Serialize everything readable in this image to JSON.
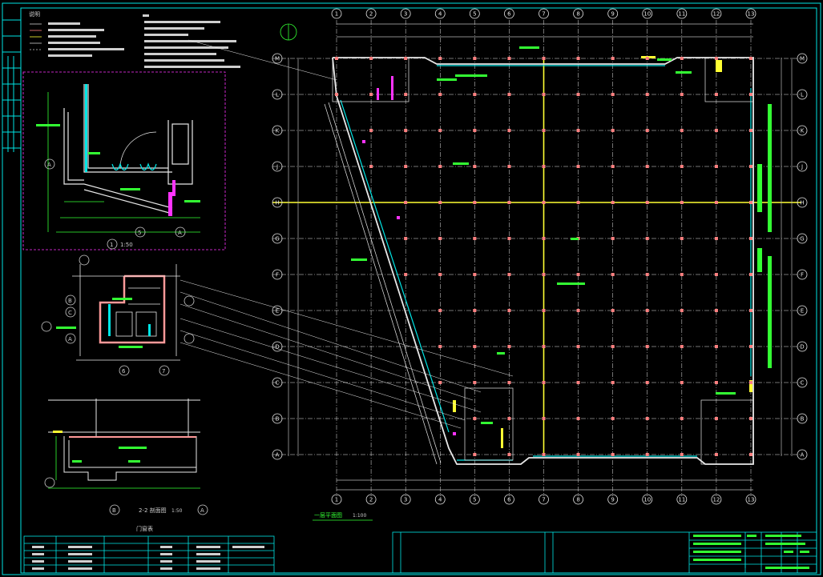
{
  "colors": {
    "background": "#000000",
    "frame": "#00e5e5",
    "grid_axis": "#e6e6e6",
    "column": "#ff8080",
    "wall": "#e8e8e8",
    "accent_yellow": "#ffff33",
    "accent_magenta": "#ff33ff",
    "label_green": "#33ff33",
    "dim": "#b8b8b8"
  },
  "plan": {
    "col_axes_top": [
      "1",
      "2",
      "3",
      "4",
      "5",
      "6",
      "7",
      "8",
      "9",
      "10",
      "11",
      "12",
      "13"
    ],
    "row_axes": [
      "M",
      "L",
      "K",
      "J",
      "H",
      "G",
      "F",
      "E",
      "D",
      "C",
      "B",
      "A"
    ],
    "title": "一层平面图",
    "scale": "1:100"
  },
  "details": {
    "detail1_title": "1",
    "detail1_scale": "1:50",
    "section_title": "2-2 剖面图",
    "section_scale": "1:50",
    "detail2_axes_left": [
      "B",
      "C",
      "A"
    ],
    "detail2_axes_bottom": [
      "6",
      "7"
    ],
    "detail1_axes": [
      "A",
      "5",
      "A"
    ],
    "section_axes": [
      "B",
      "A"
    ]
  },
  "notes_title": "说明",
  "table_title": "门窗表"
}
